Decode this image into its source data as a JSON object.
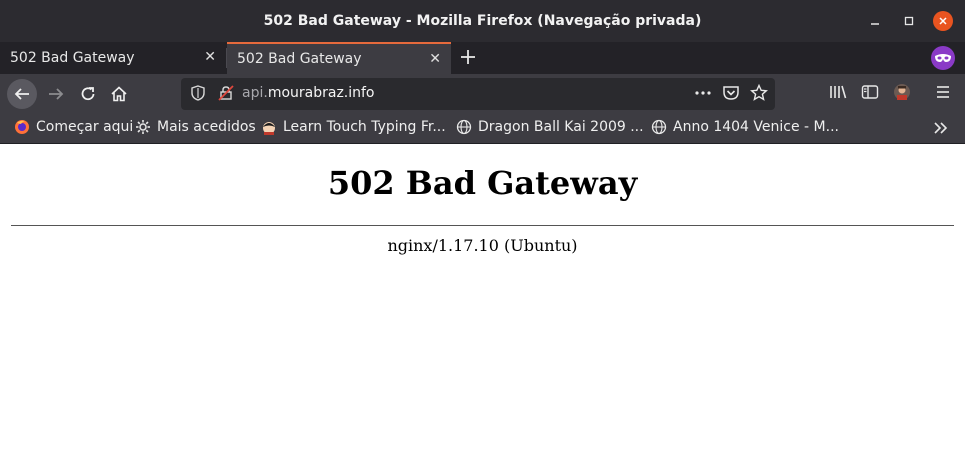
{
  "window": {
    "title": "502 Bad Gateway - Mozilla Firefox (Navegação privada)"
  },
  "tabs": [
    {
      "label": "502 Bad Gateway",
      "active": false
    },
    {
      "label": "502 Bad Gateway",
      "active": true
    }
  ],
  "url": {
    "prefix": "api.",
    "domain": "mourabraz.info"
  },
  "bookmarks": [
    {
      "label": "Começar aqui",
      "icon": "firefox-icon"
    },
    {
      "label": "Mais acedidos",
      "icon": "gear-icon"
    },
    {
      "label": "Learn Touch Typing Fr...",
      "icon": "typing-club-icon"
    },
    {
      "label": "Dragon Ball Kai 2009 ...",
      "icon": "globe-icon"
    },
    {
      "label": "Anno 1404 Venice - M...",
      "icon": "globe-icon"
    }
  ],
  "page": {
    "heading": "502 Bad Gateway",
    "server": "nginx/1.17.10 (Ubuntu)"
  },
  "colors": {
    "accent": "#e66a3c",
    "close_button": "#e95420",
    "private_badge": "#8a3ac7"
  }
}
